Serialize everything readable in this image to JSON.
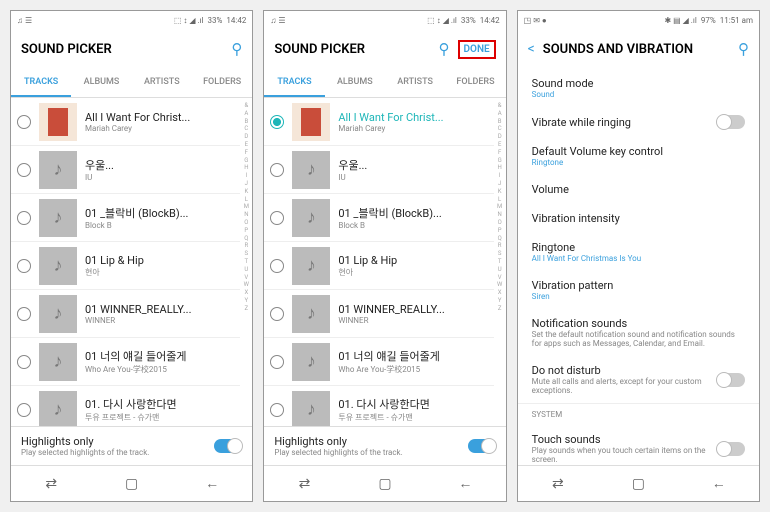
{
  "status": {
    "left_icons": "♫ ☰",
    "right1": "33%",
    "time1": "14:42",
    "right3": "97%",
    "time3": "11:51 am",
    "signal": "⬚ ↕ ◢ .ıl"
  },
  "picker": {
    "title": "SOUND PICKER",
    "tabs": [
      "TRACKS",
      "ALBUMS",
      "ARTISTS",
      "FOLDERS"
    ],
    "done": "DONE",
    "highlights": {
      "title": "Highlights only",
      "sub": "Play selected highlights of the track."
    },
    "index": [
      "&",
      "A",
      "B",
      "C",
      "D",
      "E",
      "F",
      "G",
      "H",
      "I",
      "J",
      "K",
      "L",
      "M",
      "N",
      "O",
      "P",
      "Q",
      "R",
      "S",
      "T",
      "U",
      "V",
      "W",
      "X",
      "Y",
      "Z"
    ]
  },
  "tracks": [
    {
      "title": "All I Want For Christ...",
      "artist": "Mariah Carey",
      "album": true
    },
    {
      "title": "&#50864;&#50872;...",
      "artist": "IU"
    },
    {
      "title": "01 _블락비 (BlockB)...",
      "artist": "Block B"
    },
    {
      "title": "01 Lip & Hip",
      "artist": "현아"
    },
    {
      "title": "01 WINNER_REALLY...",
      "artist": "WINNER"
    },
    {
      "title": "01 너의 얘길 들어줄게",
      "artist": "Who Are You-学校2015"
    },
    {
      "title": "01. 다시 사랑한다면",
      "artist": "투유 프로젝트 - 슈가맨"
    }
  ],
  "settings": {
    "title": "SOUNDS AND VIBRATION",
    "items": [
      {
        "title": "Sound mode",
        "sub": "Sound",
        "blue": true
      },
      {
        "title": "Vibrate while ringing",
        "toggle": true
      },
      {
        "title": "Default Volume key control",
        "sub": "Ringtone",
        "blue": true
      },
      {
        "title": "Volume"
      },
      {
        "title": "Vibration intensity"
      },
      {
        "title": "Ringtone",
        "sub": "All I Want For Christmas Is You",
        "blue": true
      },
      {
        "title": "Vibration pattern",
        "sub": "Siren",
        "blue": true
      },
      {
        "title": "Notification sounds",
        "sub": "Set the default notification sound and notification sounds for apps such as Messages, Calendar, and Email.",
        "gray": true
      },
      {
        "title": "Do not disturb",
        "sub": "Mute all calls and alerts, except for your custom exceptions.",
        "gray": true,
        "toggle": true
      }
    ],
    "system": "SYSTEM",
    "touch": {
      "title": "Touch sounds",
      "sub": "Play sounds when you touch certain items on the screen.",
      "toggle": true
    }
  }
}
